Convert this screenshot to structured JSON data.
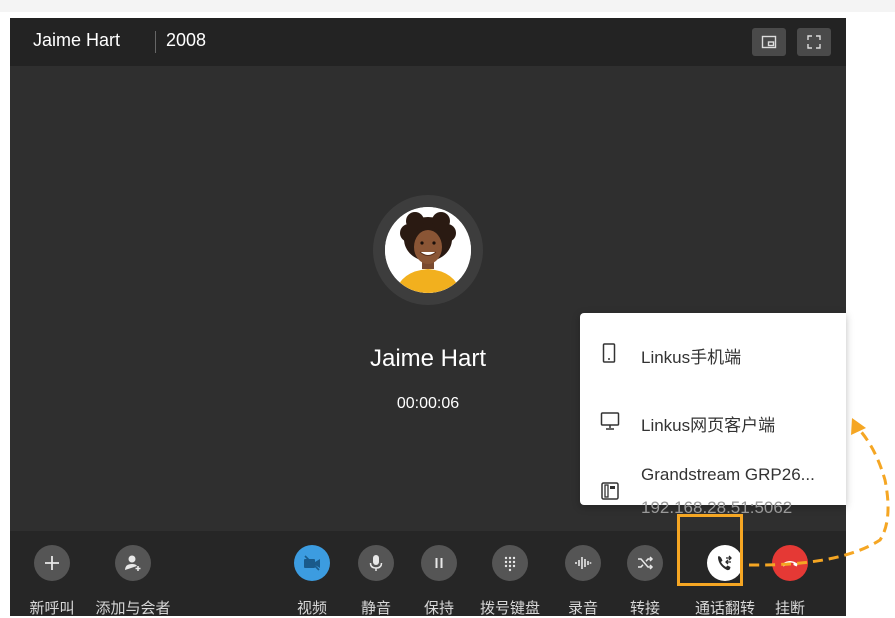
{
  "window": {
    "caller_name": "Jaime Hart",
    "extension": "2008",
    "status_timer": "00:00:06"
  },
  "transfer_menu": {
    "items": [
      {
        "icon": "mobile-icon",
        "label": "Linkus手机端"
      },
      {
        "icon": "desktop-icon",
        "label": "Linkus网页客户端"
      },
      {
        "icon": "desk-phone-icon",
        "label": "Grandstream GRP26...",
        "sub": "192.168.28.51:5062"
      }
    ]
  },
  "toolbar": {
    "buttons": [
      {
        "icon": "plus-icon",
        "label": "新呼叫"
      },
      {
        "icon": "add-user-icon",
        "label": "添加与会者"
      },
      {
        "icon": "video-off-icon",
        "label": "视频"
      },
      {
        "icon": "microphone-icon",
        "label": "静音"
      },
      {
        "icon": "pause-icon",
        "label": "保持"
      },
      {
        "icon": "dialpad-icon",
        "label": "拨号键盘"
      },
      {
        "icon": "waveform-icon",
        "label": "录音"
      },
      {
        "icon": "shuffle-icon",
        "label": "转接"
      },
      {
        "icon": "call-flip-icon",
        "label": "通话翻转"
      },
      {
        "icon": "hang-up-icon",
        "label": "挂断"
      }
    ]
  },
  "colors": {
    "window_bg": "#2f2f2f",
    "titlebar_bg": "#232323",
    "toolbar_bg": "#262626",
    "button_gray": "#555555",
    "video_blue": "#3c9ce0",
    "hangup_red": "#e53935",
    "highlight_orange": "#f5a623"
  }
}
